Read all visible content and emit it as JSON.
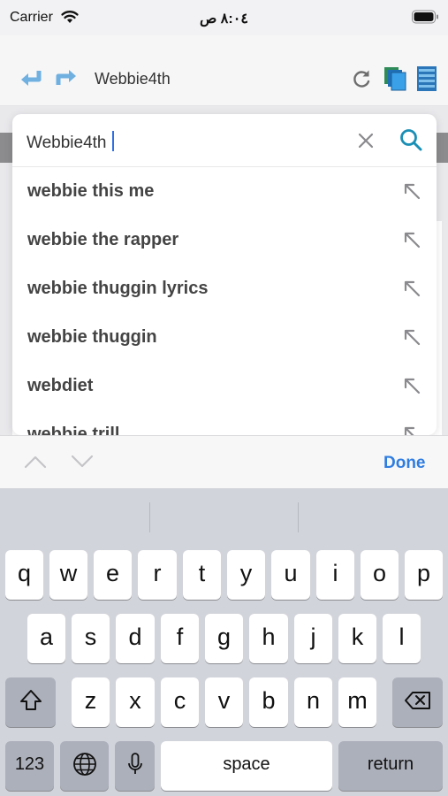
{
  "status_bar": {
    "carrier": "Carrier",
    "time": "٨:٠٤ ص"
  },
  "browser": {
    "title": "Webbie4th"
  },
  "search": {
    "query": "Webbie4th",
    "suggestions": [
      "webbie this me",
      "webbie the rapper",
      "webbie thuggin lyrics",
      "webbie thuggin",
      "webdiet",
      "webbie trill"
    ]
  },
  "accessory": {
    "done_label": "Done"
  },
  "keyboard": {
    "row1": [
      "q",
      "w",
      "e",
      "r",
      "t",
      "y",
      "u",
      "i",
      "o",
      "p"
    ],
    "row2": [
      "a",
      "s",
      "d",
      "f",
      "g",
      "h",
      "j",
      "k",
      "l"
    ],
    "row3": [
      "z",
      "x",
      "c",
      "v",
      "b",
      "n",
      "m"
    ],
    "numbers_label": "123",
    "space_label": "space",
    "return_label": "return"
  },
  "colors": {
    "accent": "#2f7de1",
    "nav_arrow": "#6fb0e0",
    "keyboard_bg": "#d2d4db",
    "key_gray": "#acb0ba"
  }
}
